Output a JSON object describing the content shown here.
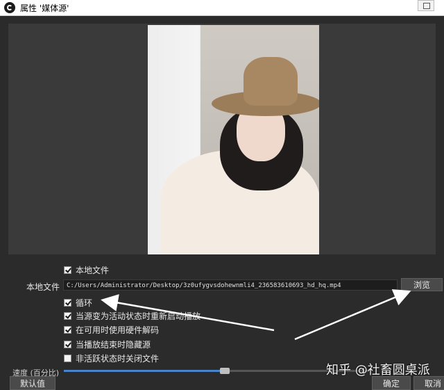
{
  "window": {
    "title": "属性 '媒体源'"
  },
  "form": {
    "local_file_checkbox": {
      "label": "本地文件",
      "checked": true
    },
    "local_file_field_label": "本地文件",
    "local_file_path": "C:/Users/Administrator/Desktop/3z0ufygvsdohewnmli4_236583610693_hd_hq.mp4",
    "browse_label": "浏览",
    "options": [
      {
        "label": "循环",
        "checked": true
      },
      {
        "label": "当源变为活动状态时重新启动播放",
        "checked": true
      },
      {
        "label": "在可用时使用硬件解码",
        "checked": true
      },
      {
        "label": "当播放结束时隐藏源",
        "checked": true
      },
      {
        "label": "非活跃状态时关闭文件",
        "checked": false
      }
    ],
    "speed_label": "速度 (百分比)",
    "speed_fill_fraction": 0.52
  },
  "footer": {
    "defaults_label": "默认值",
    "ok_label": "确定",
    "cancel_label": "取消"
  },
  "watermark": "知乎 @社畜圆桌派",
  "colors": {
    "arrow": "#ffffff",
    "slider_fill": "#4a84c8"
  }
}
